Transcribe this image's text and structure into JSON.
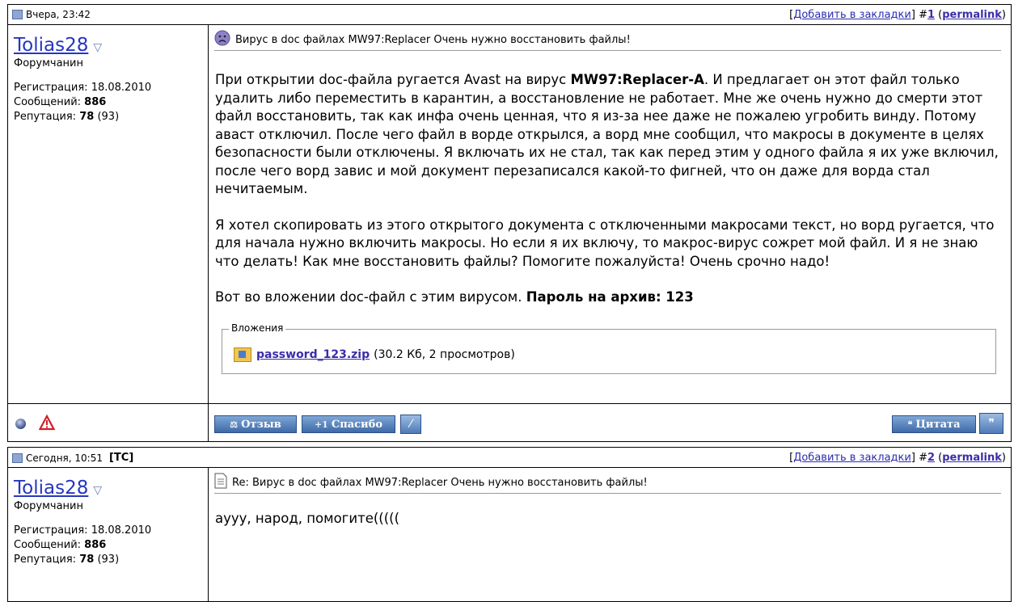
{
  "posts": [
    {
      "timestamp": "Вчера, 23:42",
      "tc": "",
      "bookmark": "Добавить в закладки",
      "number_prefix": "#",
      "number": "1",
      "permalink": "permalink",
      "user": {
        "name": "Tolias28",
        "rank": "Форумчанин",
        "reg_label": "Регистрация:",
        "reg_value": "18.08.2010",
        "msg_label": "Сообщений:",
        "msg_value": "886",
        "rep_label": "Репутация:",
        "rep_value": "78",
        "rep_extra": "(93)"
      },
      "title": "Вирус в doc файлах MW97:Replacer Очень нужно восстановить файлы!",
      "p1_a": "При открытии doc-файла ругается Avast на вирус ",
      "p1_b": "MW97:Replacer-A",
      "p1_c": ". И предлагает он этот файл только удалить либо переместить в карантин, а восстановление не работает. Мне же очень нужно до смерти этот файл восстановить, так как инфа очень ценная, что я из-за нее даже не пожалею угробить винду. Потому аваст отключил. После чего файл в ворде открылся, а ворд мне сообщил, что макросы в документе в целях безопасности были отключены. Я включать их не стал, так как перед этим у одного файла я их уже включил, после чего ворд завис и мой документ перезаписался какой-то фигней, что он даже для ворда стал нечитаемым.",
      "p2": "Я хотел скопировать из этого открытого документа с отключенными макросами текст, но ворд ругается, что для начала нужно включить макросы. Но если я их включу, то макрос-вирус сожрет мой файл. И я не знаю что делать! Как мне восстановить файлы? Помогите пожалуйста! Очень срочно надо!",
      "p3_a": "Вот во вложении doc-файл с этим вирусом. ",
      "p3_b": "Пароль на архив: 123",
      "attachments_legend": "Вложения",
      "attachment_name": "password_123.zip",
      "attachment_meta": "(30.2 Кб, 2 просмотров)",
      "buttons": {
        "review": "Отзыв",
        "thanks": "Спасибо",
        "quote": "Цитата"
      }
    },
    {
      "timestamp": "Сегодня, 10:51",
      "tc": "[ТС]",
      "bookmark": "Добавить в закладки",
      "number_prefix": "#",
      "number": "2",
      "permalink": "permalink",
      "user": {
        "name": "Tolias28",
        "rank": "Форумчанин",
        "reg_label": "Регистрация:",
        "reg_value": "18.08.2010",
        "msg_label": "Сообщений:",
        "msg_value": "886",
        "rep_label": "Репутация:",
        "rep_value": "78",
        "rep_extra": "(93)"
      },
      "title": "Re: Вирус в doc файлах MW97:Replacer Очень нужно восстановить файлы!",
      "body": "аууу, народ, помогите((((("
    }
  ]
}
